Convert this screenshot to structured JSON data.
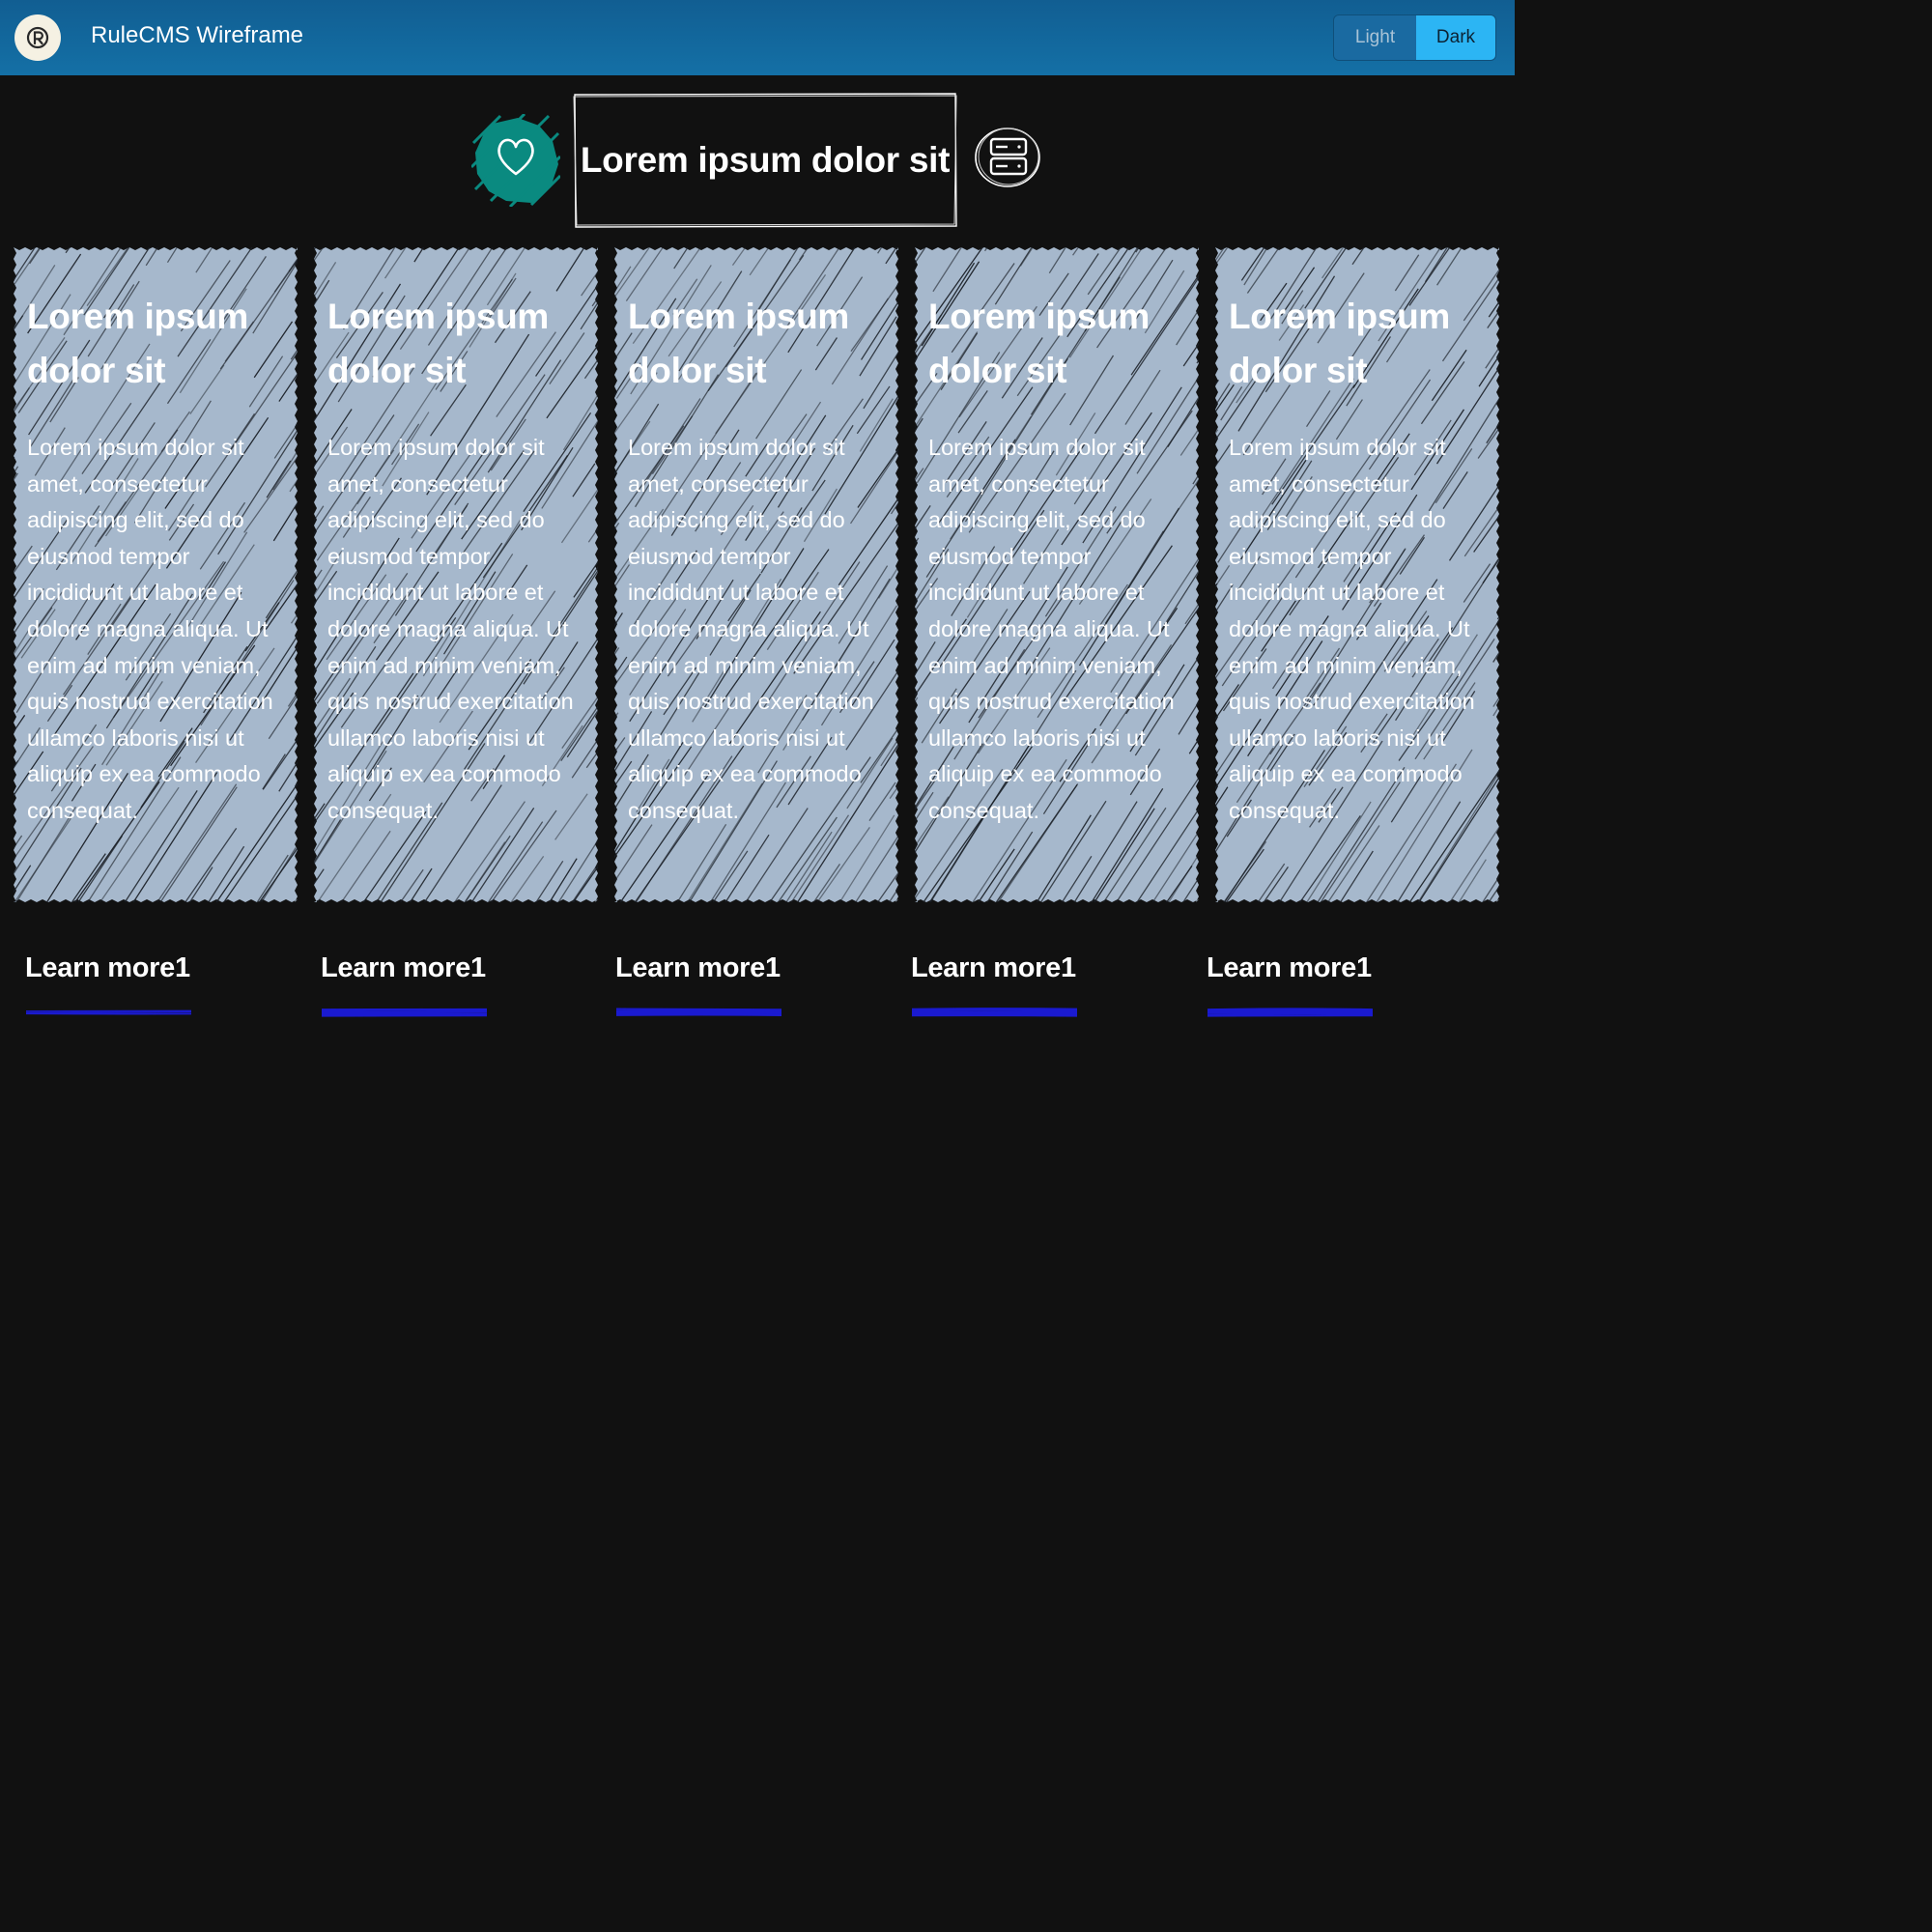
{
  "header": {
    "app_title": "RuleCMS Wireframe",
    "logo_icon": "rulecms-logo-icon",
    "theme": {
      "light_label": "Light",
      "dark_label": "Dark",
      "selected": "Dark"
    }
  },
  "hero": {
    "title": "Lorem ipsum dolor sit",
    "left_icon": "heart-icon",
    "right_icon": "server-icon"
  },
  "cards": [
    {
      "title": "Lorem ipsum dolor sit",
      "body": "Lorem ipsum dolor sit amet, consectetur adipiscing elit, sed do eiusmod tempor incididunt ut labore et dolore magna aliqua. Ut enim ad minim veniam, quis nostrud exercitation ullamco laboris nisi ut aliquip ex ea commodo consequat.",
      "link": "Learn more1"
    },
    {
      "title": "Lorem ipsum dolor sit",
      "body": "Lorem ipsum dolor sit amet, consectetur adipiscing elit, sed do eiusmod tempor incididunt ut labore et dolore magna aliqua. Ut enim ad minim veniam, quis nostrud exercitation ullamco laboris nisi ut aliquip ex ea commodo consequat.",
      "link": "Learn more1"
    },
    {
      "title": "Lorem ipsum dolor sit",
      "body": "Lorem ipsum dolor sit amet, consectetur adipiscing elit, sed do eiusmod tempor incididunt ut labore et dolore magna aliqua. Ut enim ad minim veniam, quis nostrud exercitation ullamco laboris nisi ut aliquip ex ea commodo consequat.",
      "link": "Learn more1"
    },
    {
      "title": "Lorem ipsum dolor sit",
      "body": "Lorem ipsum dolor sit amet, consectetur adipiscing elit, sed do eiusmod tempor incididunt ut labore et dolore magna aliqua. Ut enim ad minim veniam, quis nostrud exercitation ullamco laboris nisi ut aliquip ex ea commodo consequat.",
      "link": "Learn more1"
    },
    {
      "title": "Lorem ipsum dolor sit",
      "body": "Lorem ipsum dolor sit amet, consectetur adipiscing elit, sed do eiusmod tempor incididunt ut labore et dolore magna aliqua. Ut enim ad minim veniam, quis nostrud exercitation ullamco laboris nisi ut aliquip ex ea commodo consequat.",
      "link": "Learn more1"
    }
  ],
  "colors": {
    "page_background": "#111111",
    "header_background": "#1368a0",
    "dark_button": "#2cb5f4",
    "card_fill": "#a6b8cc",
    "heart_blob": "#0a8a80",
    "link_underline": "#1a1ad0"
  }
}
